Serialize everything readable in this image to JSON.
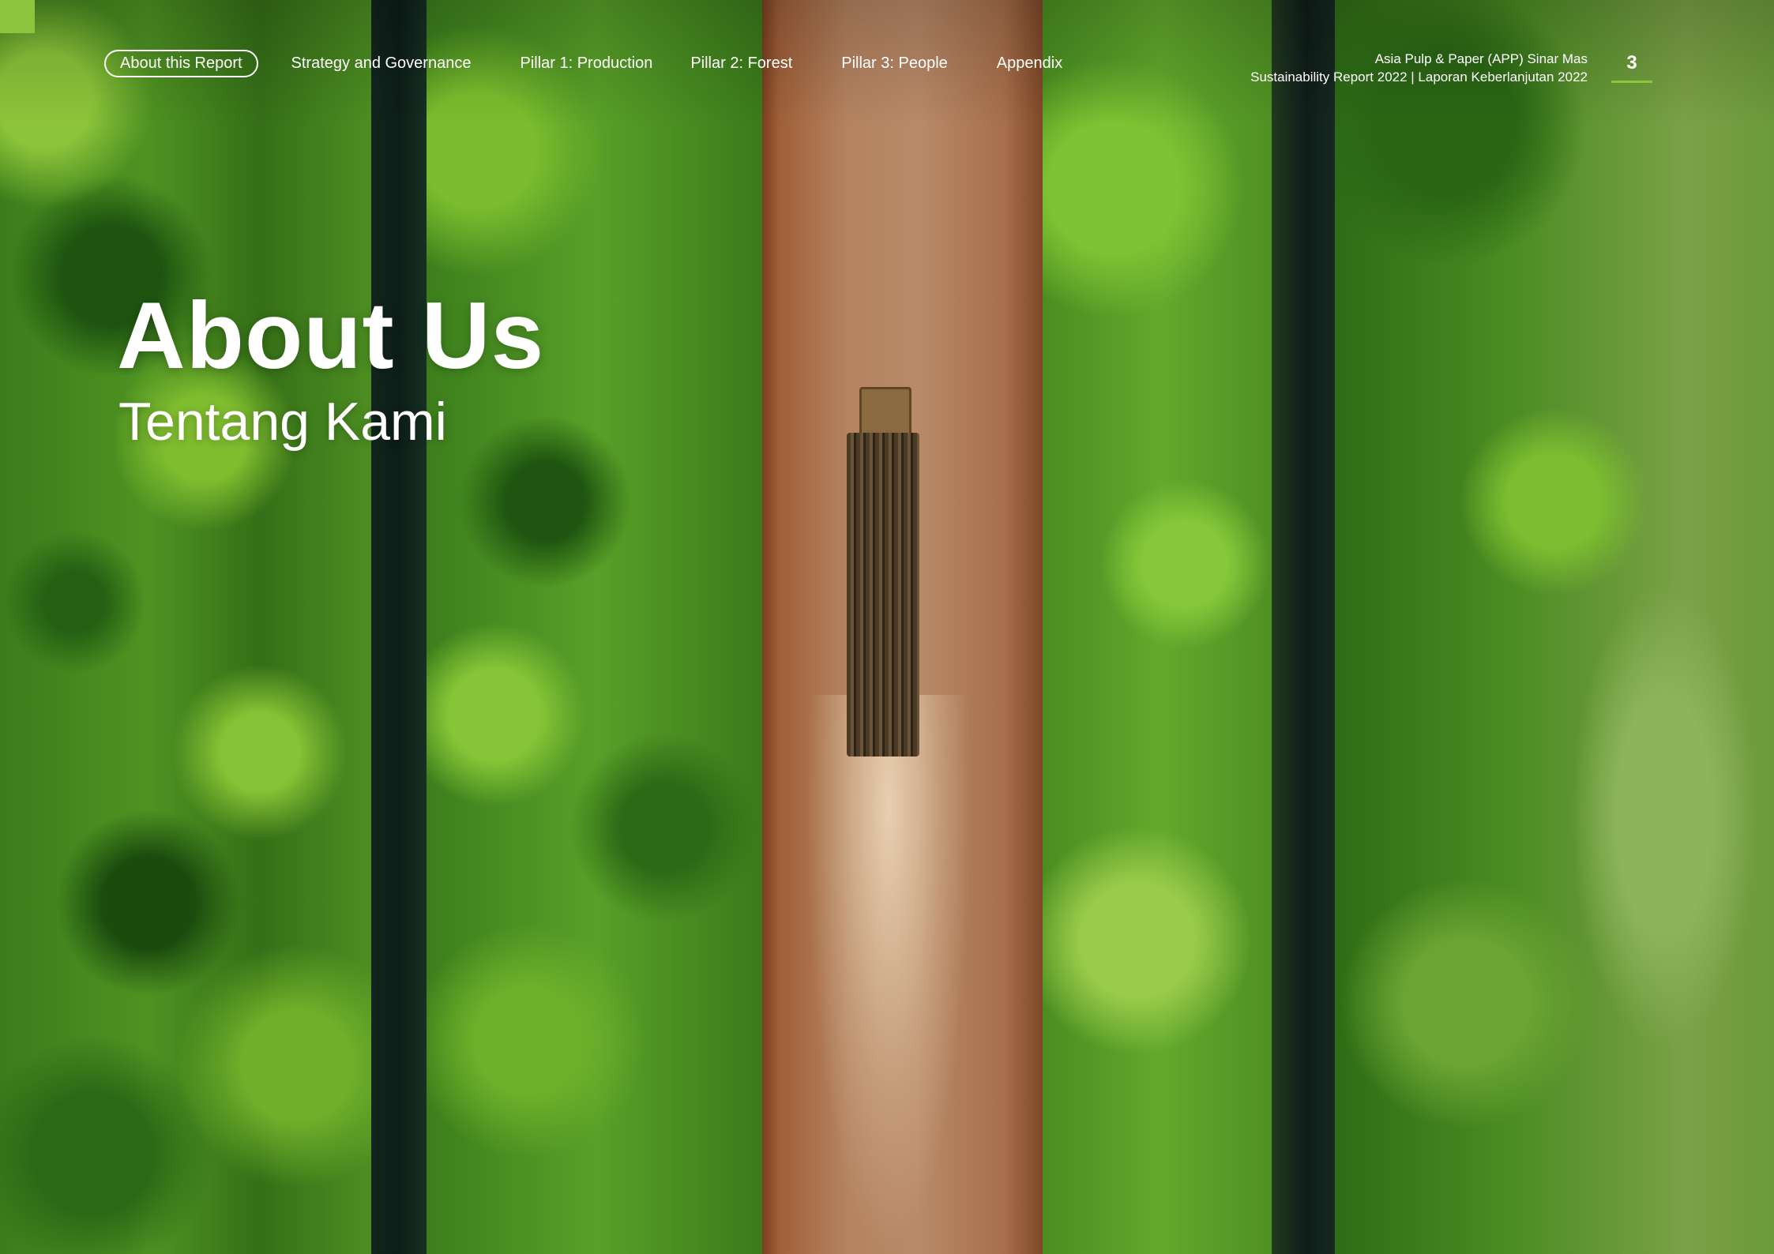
{
  "nav": {
    "items": [
      {
        "label": "About this Report",
        "active": true
      },
      {
        "label": "Strategy and Governance",
        "active": false
      },
      {
        "label": "Pillar 1: Production",
        "active": false
      },
      {
        "label": "Pillar 2: Forest",
        "active": false
      },
      {
        "label": "Pillar 3: People",
        "active": false
      },
      {
        "label": "Appendix",
        "active": false
      }
    ]
  },
  "header": {
    "company": "Asia Pulp & Paper (APP) Sinar Mas",
    "report": "Sustainability Report 2022 | Laporan Keberlanjutan 2022",
    "page_number": "3"
  },
  "hero": {
    "title": "About Us",
    "subtitle": "Tentang Kami"
  },
  "colors": {
    "accent": "#8cc63f"
  }
}
